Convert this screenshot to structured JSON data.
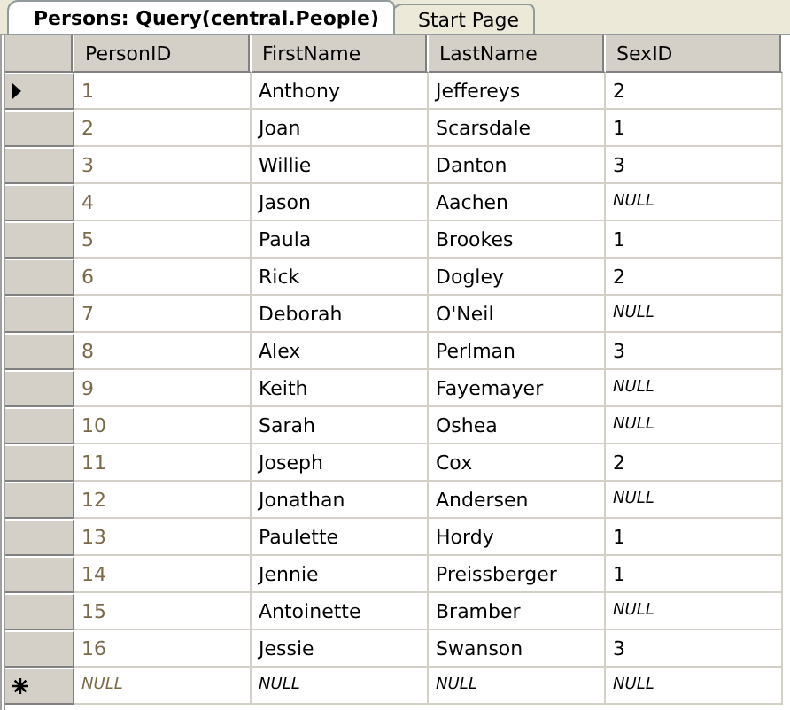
{
  "tabs": [
    {
      "label": "Persons: Query(central.People)",
      "selected": true
    },
    {
      "label": "Start Page",
      "selected": false
    }
  ],
  "grid": {
    "columns": [
      {
        "label": "PersonID",
        "readonly": true
      },
      {
        "label": "FirstName",
        "readonly": false
      },
      {
        "label": "LastName",
        "readonly": false
      },
      {
        "label": "SexID",
        "readonly": false
      }
    ],
    "rows": [
      {
        "selected": true,
        "cells": [
          "1",
          "Anthony",
          "Jeffereys",
          "2"
        ]
      },
      {
        "selected": false,
        "cells": [
          "2",
          "Joan",
          "Scarsdale",
          "1"
        ]
      },
      {
        "selected": false,
        "cells": [
          "3",
          "Willie",
          "Danton",
          "3"
        ]
      },
      {
        "selected": false,
        "cells": [
          "4",
          "Jason",
          "Aachen",
          {
            "text": "NULL",
            "kind": "null"
          }
        ]
      },
      {
        "selected": false,
        "cells": [
          "5",
          "Paula",
          "Brookes",
          "1"
        ]
      },
      {
        "selected": false,
        "cells": [
          "6",
          "Rick",
          "Dogley",
          "2"
        ]
      },
      {
        "selected": false,
        "cells": [
          "7",
          "Deborah",
          "O'Neil",
          {
            "text": "NULL",
            "kind": "null"
          }
        ]
      },
      {
        "selected": false,
        "cells": [
          "8",
          "Alex",
          "Perlman",
          "3"
        ]
      },
      {
        "selected": false,
        "cells": [
          "9",
          "Keith",
          "Fayemayer",
          {
            "text": "NULL",
            "kind": "null"
          }
        ]
      },
      {
        "selected": false,
        "cells": [
          "10",
          "Sarah",
          "Oshea",
          {
            "text": "NULL",
            "kind": "null"
          }
        ]
      },
      {
        "selected": false,
        "cells": [
          "11",
          "Joseph",
          "Cox",
          "2"
        ]
      },
      {
        "selected": false,
        "cells": [
          "12",
          "Jonathan",
          "Andersen",
          {
            "text": "NULL",
            "kind": "null"
          }
        ]
      },
      {
        "selected": false,
        "cells": [
          "13",
          "Paulette",
          "Hordy",
          "1"
        ]
      },
      {
        "selected": false,
        "cells": [
          "14",
          "Jennie",
          "Preissberger",
          "1"
        ]
      },
      {
        "selected": false,
        "cells": [
          "15",
          "Antoinette",
          "Bramber",
          {
            "text": "NULL",
            "kind": "null"
          }
        ]
      },
      {
        "selected": false,
        "cells": [
          "16",
          "Jessie",
          "Swanson",
          "3"
        ]
      }
    ],
    "new_row": {
      "cells": [
        {
          "text": "NULL",
          "kind": "null"
        },
        {
          "text": "NULL",
          "kind": "null"
        },
        {
          "text": "NULL",
          "kind": "null"
        },
        {
          "text": "NULL",
          "kind": "null"
        }
      ]
    }
  }
}
